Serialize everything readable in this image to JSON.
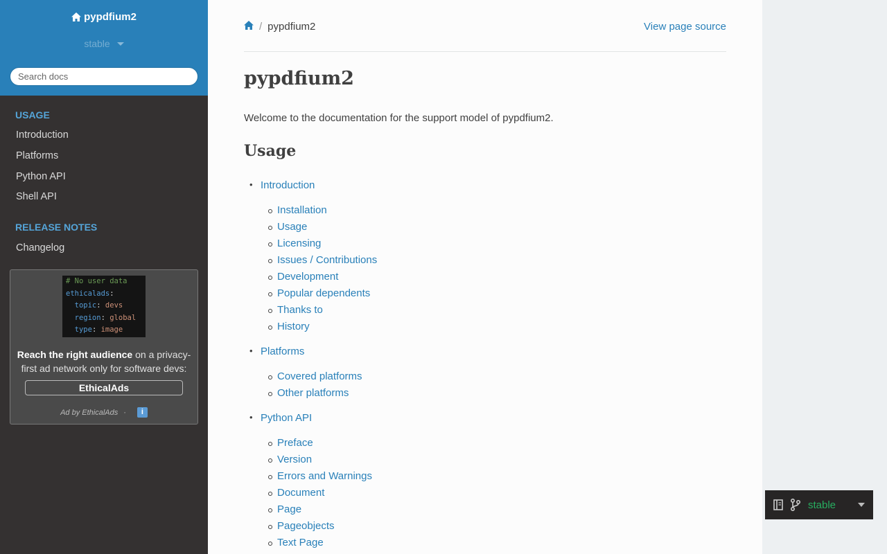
{
  "sidebar": {
    "project_title": "pypdfium2",
    "version_label": "stable",
    "search_placeholder": "Search docs",
    "sections": [
      {
        "caption": "USAGE",
        "items": [
          "Introduction",
          "Platforms",
          "Python API",
          "Shell API"
        ]
      },
      {
        "caption": "RELEASE NOTES",
        "items": [
          "Changelog"
        ]
      }
    ]
  },
  "ad": {
    "code_lines": [
      [
        "# No user data"
      ],
      [
        "ethicalads",
        ":"
      ],
      [
        "  topic",
        ": ",
        "devs"
      ],
      [
        "  region",
        ": ",
        "global"
      ],
      [
        "  type",
        ": ",
        "image"
      ]
    ],
    "text_bold": "Reach the right audience",
    "text_rest": " on a privacy-first ad network only for software devs:",
    "cta": "EthicalAds",
    "by": "Ad by EthicalAds",
    "dot": "·",
    "info": "i"
  },
  "breadcrumb": {
    "current": "pypdfium2",
    "separator": "/",
    "view_source": "View page source"
  },
  "page": {
    "title": "pypdfium2",
    "intro": "Welcome to the documentation for the support model of pypdfium2.",
    "usage_heading": "Usage"
  },
  "toc": [
    {
      "label": "Introduction",
      "children": [
        "Installation",
        "Usage",
        "Licensing",
        "Issues / Contributions",
        "Development",
        "Popular dependents",
        "Thanks to",
        "History"
      ]
    },
    {
      "label": "Platforms",
      "children": [
        "Covered platforms",
        "Other platforms"
      ]
    },
    {
      "label": "Python API",
      "children": [
        "Preface",
        "Version",
        "Errors and Warnings",
        "Document",
        "Page",
        "Pageobjects",
        "Text Page"
      ]
    }
  ],
  "flyout": {
    "version": "stable"
  },
  "colors": {
    "sidebar_top": "#2980b9",
    "sidebar_bg": "#343131",
    "link": "#2980b9",
    "caption": "#55a5d9",
    "flyout_text": "#27ae60"
  }
}
